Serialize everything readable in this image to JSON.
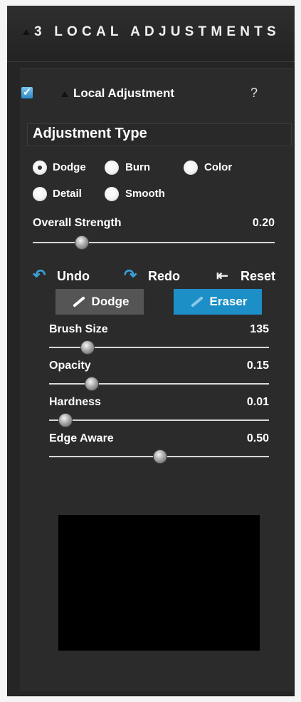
{
  "header": {
    "title": "3 LOCAL ADJUSTMENTS"
  },
  "local_adjustment": {
    "label": "Local Adjustment",
    "checked": true,
    "check_glyph": "✓",
    "help": "?"
  },
  "adjustment_type": {
    "title": "Adjustment Type",
    "options": [
      {
        "label": "Dodge",
        "selected": true
      },
      {
        "label": "Burn",
        "selected": false
      },
      {
        "label": "Color",
        "selected": false
      },
      {
        "label": "Detail",
        "selected": false
      },
      {
        "label": "Smooth",
        "selected": false
      }
    ]
  },
  "overall_strength": {
    "label": "Overall Strength",
    "value": "0.20",
    "fraction": 0.2
  },
  "actions": {
    "undo": "Undo",
    "undo_icon": "↶",
    "redo": "Redo",
    "redo_icon": "↷",
    "reset": "Reset",
    "reset_icon": "⇤"
  },
  "brush_modes": {
    "dodge": "Dodge",
    "eraser": "Eraser",
    "active": "eraser"
  },
  "brush_settings": [
    {
      "label": "Brush Size",
      "value": "135",
      "fraction": 0.17
    },
    {
      "label": "Opacity",
      "value": "0.15",
      "fraction": 0.19
    },
    {
      "label": "Hardness",
      "value": "0.01",
      "fraction": 0.07
    },
    {
      "label": "Edge Aware",
      "value": "0.50",
      "fraction": 0.5
    }
  ],
  "icons": {
    "checkbox": "check-icon",
    "help": "help-icon",
    "undo": "undo-icon",
    "redo": "redo-icon",
    "reset": "reset-icon",
    "brush": "brush-icon"
  },
  "colors": {
    "accent": "#1d8fc7",
    "panel": "#2b2b2b",
    "header": "#252525"
  }
}
